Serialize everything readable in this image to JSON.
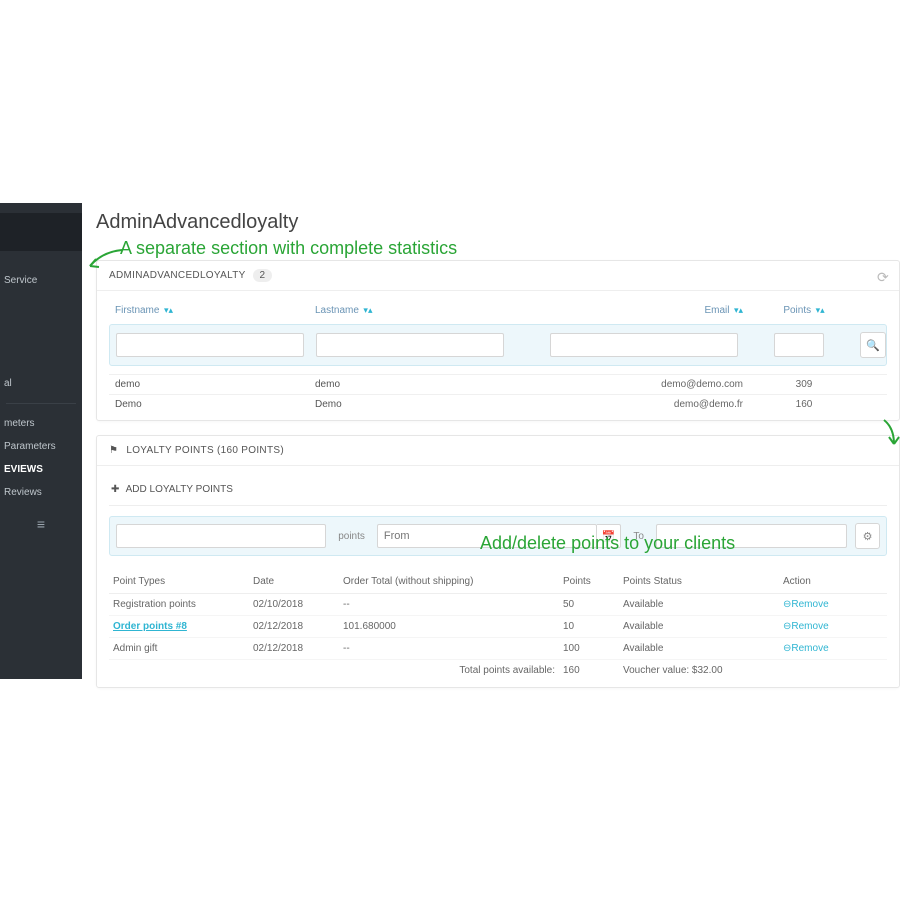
{
  "sidebar": {
    "items": [
      "",
      "Service",
      "",
      "al",
      "meters",
      "Parameters",
      "EVIEWS",
      "Reviews"
    ],
    "active_heading": "EVIEWS"
  },
  "page": {
    "title": "AdminAdvancedloyalty"
  },
  "annotations": {
    "a1": "A separate section with complete statistics",
    "a2": "Add/delete points to your clients"
  },
  "panel1": {
    "title": "ADMINADVANCEDLOYALTY",
    "count": "2",
    "columns": {
      "first": "Firstname",
      "last": "Lastname",
      "email": "Email",
      "points": "Points"
    },
    "rows": [
      {
        "first": "demo",
        "last": "demo",
        "email": "demo@demo.com",
        "points": "309"
      },
      {
        "first": "Demo",
        "last": "Demo",
        "email": "demo@demo.fr",
        "points": "160"
      }
    ]
  },
  "panel2": {
    "title": "LOYALTY POINTS (160 POINTS)",
    "add_title": "ADD LOYALTY POINTS",
    "labels": {
      "points": "points",
      "from_ph": "From",
      "to_ph": "To"
    },
    "columns": {
      "type": "Point Types",
      "date": "Date",
      "order_total": "Order Total (without shipping)",
      "points": "Points",
      "status": "Points Status",
      "action": "Action"
    },
    "rows": [
      {
        "type": "Registration points",
        "date": "02/10/2018",
        "order_total": "--",
        "points": "50",
        "status": "Available",
        "action": "Remove",
        "link": false
      },
      {
        "type": "Order points #8",
        "date": "02/12/2018",
        "order_total": "101.680000",
        "points": "10",
        "status": "Available",
        "action": "Remove",
        "link": true
      },
      {
        "type": "Admin gift",
        "date": "02/12/2018",
        "order_total": "--",
        "points": "100",
        "status": "Available",
        "action": "Remove",
        "link": false
      }
    ],
    "summary": {
      "label": "Total points available:",
      "points": "160",
      "voucher_label": "Voucher value:",
      "voucher": "$32.00"
    }
  }
}
